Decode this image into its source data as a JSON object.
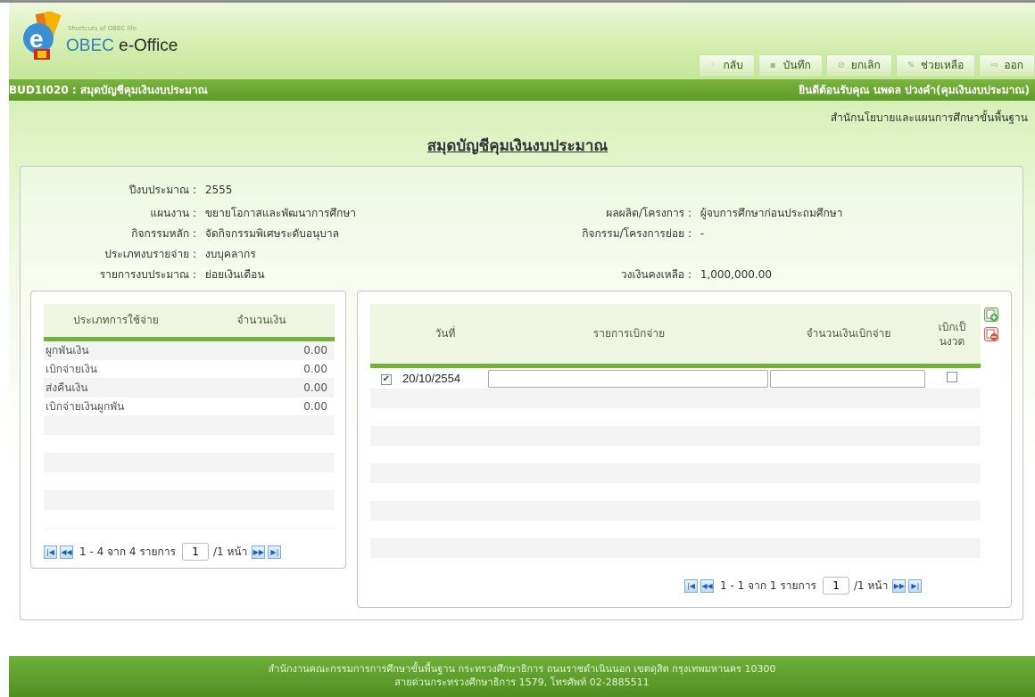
{
  "header": {
    "tagline": "Shortcuts of OBEC life",
    "brand_prefix": "OBEC",
    "brand_suffix": " e-Office"
  },
  "toolbar": [
    {
      "label": "กลับ",
      "icon": "back-icon"
    },
    {
      "label": "บันทึก",
      "icon": "save-icon"
    },
    {
      "label": "ยกเลิก",
      "icon": "cancel-icon"
    },
    {
      "label": "ช่วยเหลือ",
      "icon": "help-icon"
    },
    {
      "label": "ออก",
      "icon": "exit-icon"
    }
  ],
  "titlebar": {
    "code": "BUD1I020 : สมุดบัญชีคุมเงินงบประมาณ",
    "welcome": "ยินดีต้อนรับคุณ นพดล ปวงคำ(คุมเงินงบประมาณ)"
  },
  "org_name": "สำนักนโยบายและแผนการศึกษาขั้นพื้นฐาน",
  "page_title": "สมุดบัญชีคุมเงินงบประมาณ",
  "info": {
    "year_label": "ปีงบประมาณ :",
    "year_value": "2555",
    "plan_label": "แผนงาน :",
    "plan_value": "ขยายโอกาสและพัฒนาการศึกษา",
    "output_label": "ผลผลิต/โครงการ :",
    "output_value": "ผู้จบการศึกษาก่อนประถมศึกษา",
    "main_activity_label": "กิจกรรมหลัก :",
    "main_activity_value": "จัดกิจกรรมพิเศษระดับอนุบาล",
    "sub_activity_label": "กิจกรรม/โครงการย่อย :",
    "sub_activity_value": "-",
    "expense_type_label": "ประเภทงบรายจ่าย :",
    "expense_type_value": "งบบุคลากร",
    "budget_item_label": "รายการงบประมาณ :",
    "budget_item_value": "ย่อยเงินเดือน",
    "remaining_label": "วงเงินคงเหลือ :",
    "remaining_value": "1,000,000.00"
  },
  "left_grid": {
    "headers": [
      "ประเภทการใช้จ่าย",
      "จำนวนเงิน"
    ],
    "rows": [
      {
        "type": "ผูกพันเงิน",
        "amount": "0.00"
      },
      {
        "type": "เบิกจ่ายเงิน",
        "amount": "0.00"
      },
      {
        "type": "ส่งคืนเงิน",
        "amount": "0.00"
      },
      {
        "type": "เบิกจ่ายเงินผูกพัน",
        "amount": "0.00"
      }
    ],
    "pager": {
      "summary": "1 - 4 จาก 4 รายการ",
      "page": "1",
      "total": "/1 หน้า"
    }
  },
  "right_grid": {
    "headers": [
      "วันที่",
      "รายการเบิกจ่าย",
      "จำนวนเงินเบิกจ่าย",
      "เบิกเป็นงวด"
    ],
    "rows": [
      {
        "checked": true,
        "date": "20/10/2554",
        "item": "",
        "amount": "",
        "installment": false
      }
    ],
    "pager": {
      "summary": "1 - 1 จาก 1 รายการ",
      "page": "1",
      "total": "/1 หน้า"
    }
  },
  "footer": {
    "line1": "สำนักงานคณะกรรมการการศึกษาขั้นพื้นฐาน กระทรวงศึกษาธิการ ถนนราชดำเนินนอก เขตดุสิต กรุงเทพมหานคร 10300",
    "line2": "สายด่วนกระทรวงศึกษาธิการ 1579, โทรศัพท์ 02-2885511"
  },
  "colors": {
    "title_bar": "#6aa832",
    "grid_header_border": "#74b03c",
    "footer": "#5e9e2c"
  }
}
